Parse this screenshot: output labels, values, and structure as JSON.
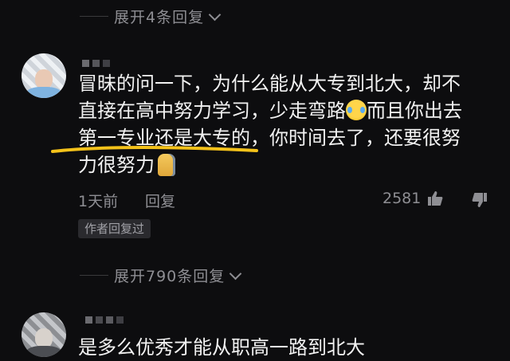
{
  "top_expand": {
    "label": "展开4条回复"
  },
  "comment": {
    "line1": "冒昧的问一下，为什么能从大专到北大，却不",
    "line2a": "直接在高中努力学习，少走弯路",
    "line2b": "而且你出去",
    "line3a": "第一专业还是大专的",
    "line3b": "，你时间去了，还要很努",
    "line4": "力很努力",
    "emoji_1": "laugh-cry-emoji",
    "emoji_2": "doge-emoji",
    "time": "1天前",
    "reply_label": "回复",
    "like_count": "2581",
    "author_badge": "作者回复过",
    "underline_color": "#f4c21a"
  },
  "middle_expand": {
    "label": "展开790条回复"
  },
  "comment2": {
    "text": "是多么优秀才能从职高一路到北大"
  },
  "colors": {
    "background": "#0d0d0f",
    "text": "#f2f2f2",
    "muted": "#8e8e93"
  }
}
